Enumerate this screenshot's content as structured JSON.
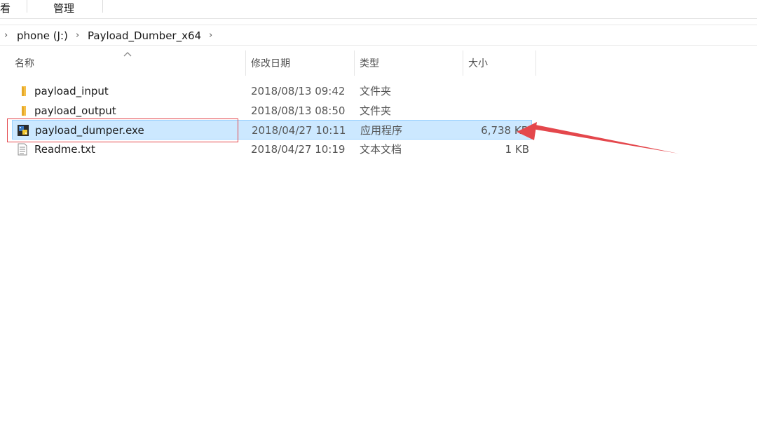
{
  "ribbon": {
    "tabs": [
      {
        "label": "看"
      },
      {
        "label": "管理"
      }
    ]
  },
  "breadcrumb": {
    "items": [
      {
        "label": "phone (J:)"
      },
      {
        "label": "Payload_Dumber_x64"
      }
    ]
  },
  "columns": {
    "name": "名称",
    "date": "修改日期",
    "type": "类型",
    "size": "大小"
  },
  "files": [
    {
      "name": "payload_input",
      "date": "2018/08/13 09:42",
      "type": "文件夹",
      "size": "",
      "icon": "folder-icon"
    },
    {
      "name": "payload_output",
      "date": "2018/08/13 08:50",
      "type": "文件夹",
      "size": "",
      "icon": "folder-icon"
    },
    {
      "name": "payload_dumper.exe",
      "date": "2018/04/27 10:11",
      "type": "应用程序",
      "size": "6,738 KB",
      "icon": "python-exe-icon",
      "selected": true
    },
    {
      "name": "Readme.txt",
      "date": "2018/04/27 10:19",
      "type": "文本文档",
      "size": "1 KB",
      "icon": "text-file-icon"
    }
  ],
  "colors": {
    "selection_bg": "#cce8ff",
    "selection_border": "#99d1ff",
    "annotation_red": "#e4474c"
  }
}
